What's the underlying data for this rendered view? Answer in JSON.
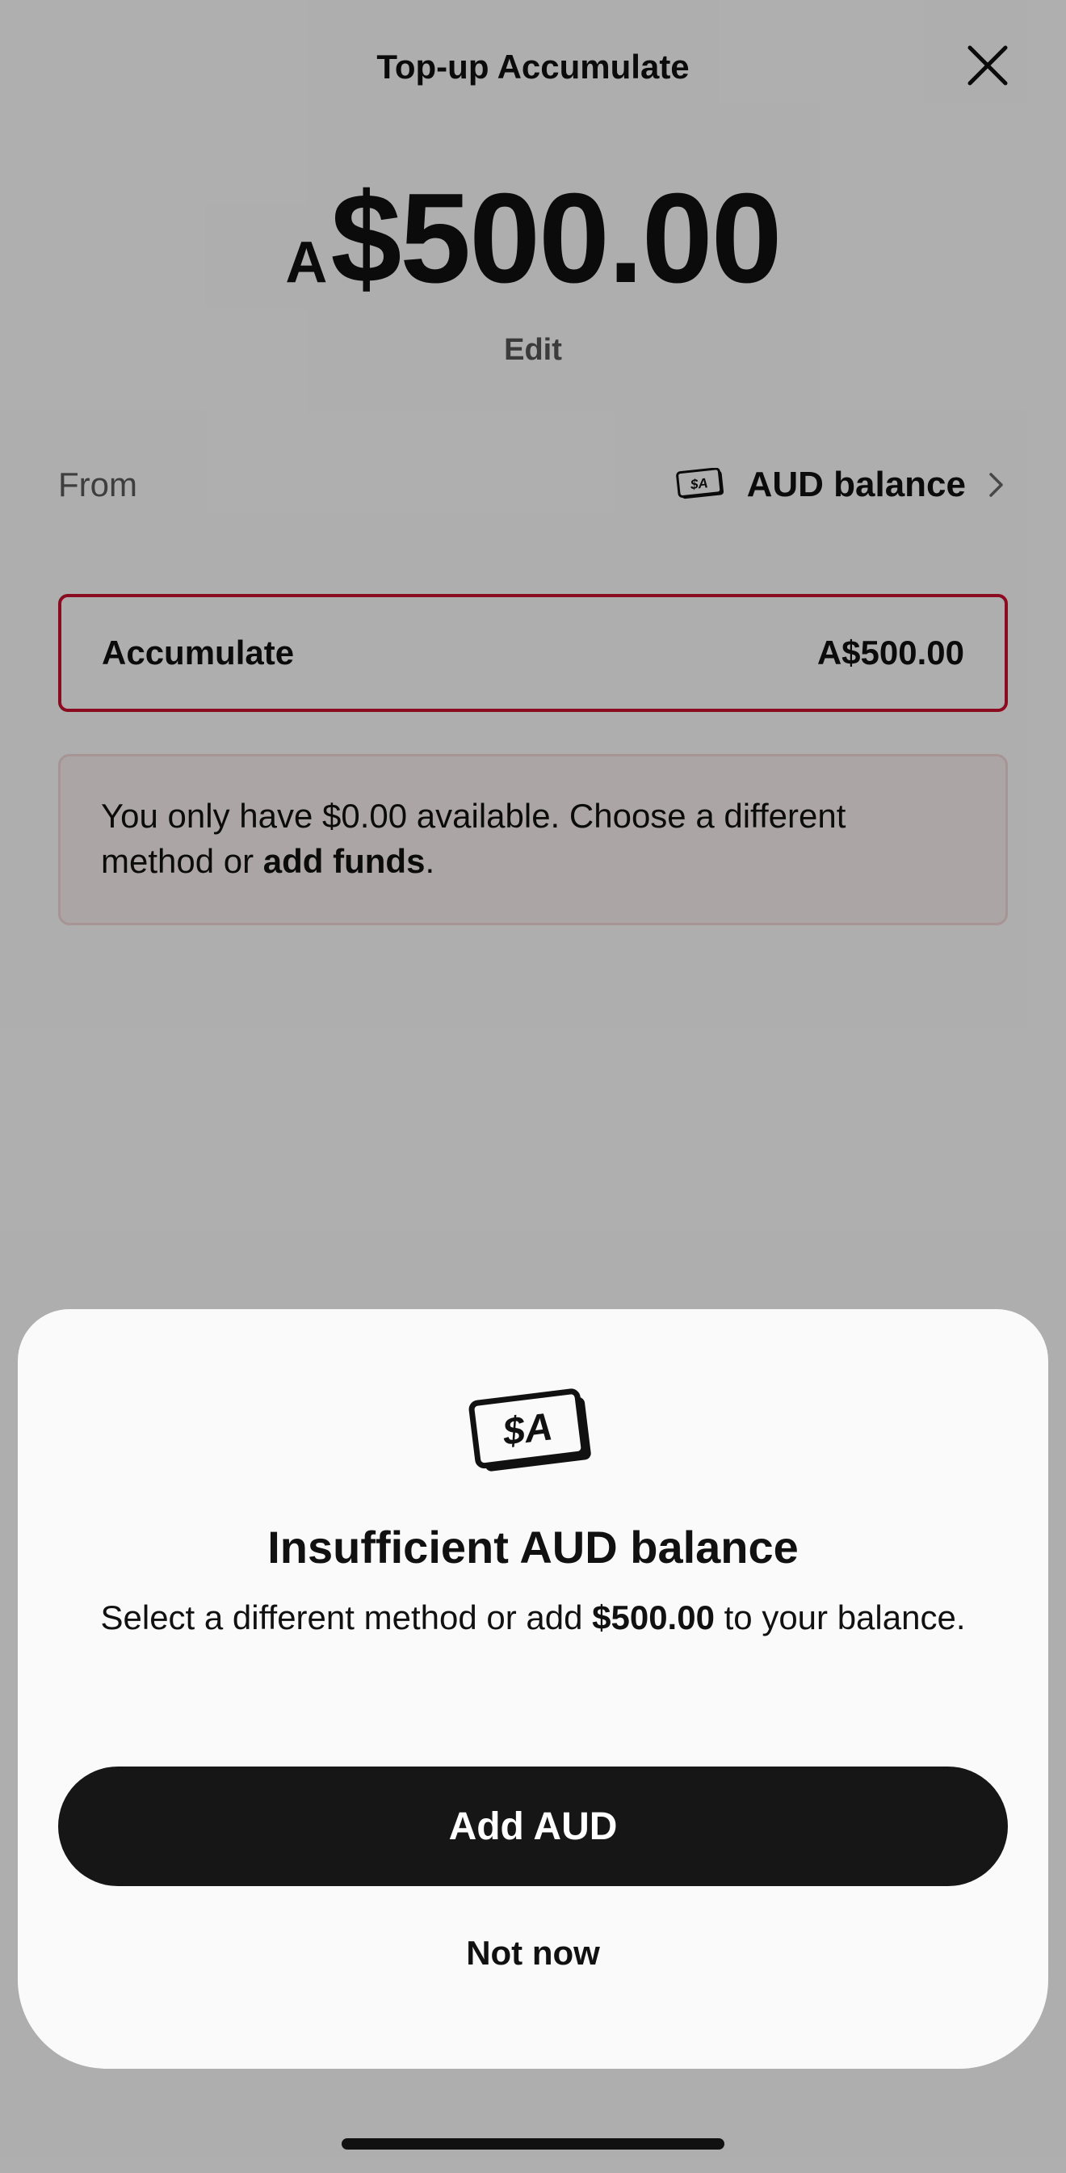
{
  "header": {
    "title": "Top-up Accumulate",
    "close_icon": "close-icon"
  },
  "amount": {
    "prefix": "A",
    "value": "$500.00",
    "edit_label": "Edit"
  },
  "from": {
    "label": "From",
    "source": "AUD balance",
    "icon": "aud-cash-icon",
    "chevron_icon": "chevron-right-icon",
    "icon_text": "$A"
  },
  "allocation": {
    "label": "Accumulate",
    "value": "A$500.00",
    "border_color": "#c8102e"
  },
  "warning": {
    "text_before": "You only have $0.00 available. Choose a different method or ",
    "link": "add funds",
    "text_after": "."
  },
  "sheet": {
    "icon": "aud-cash-icon",
    "icon_text": "$A",
    "title": "Insufficient AUD balance",
    "body_before": "Select a different method or add ",
    "body_amount": "$500.00",
    "body_after": " to your balance.",
    "primary_button": "Add AUD",
    "secondary_button": "Not now"
  },
  "colors": {
    "primary_button_bg": "#161616",
    "error_red": "#c8102e",
    "warning_bg": "#f7ecec"
  }
}
